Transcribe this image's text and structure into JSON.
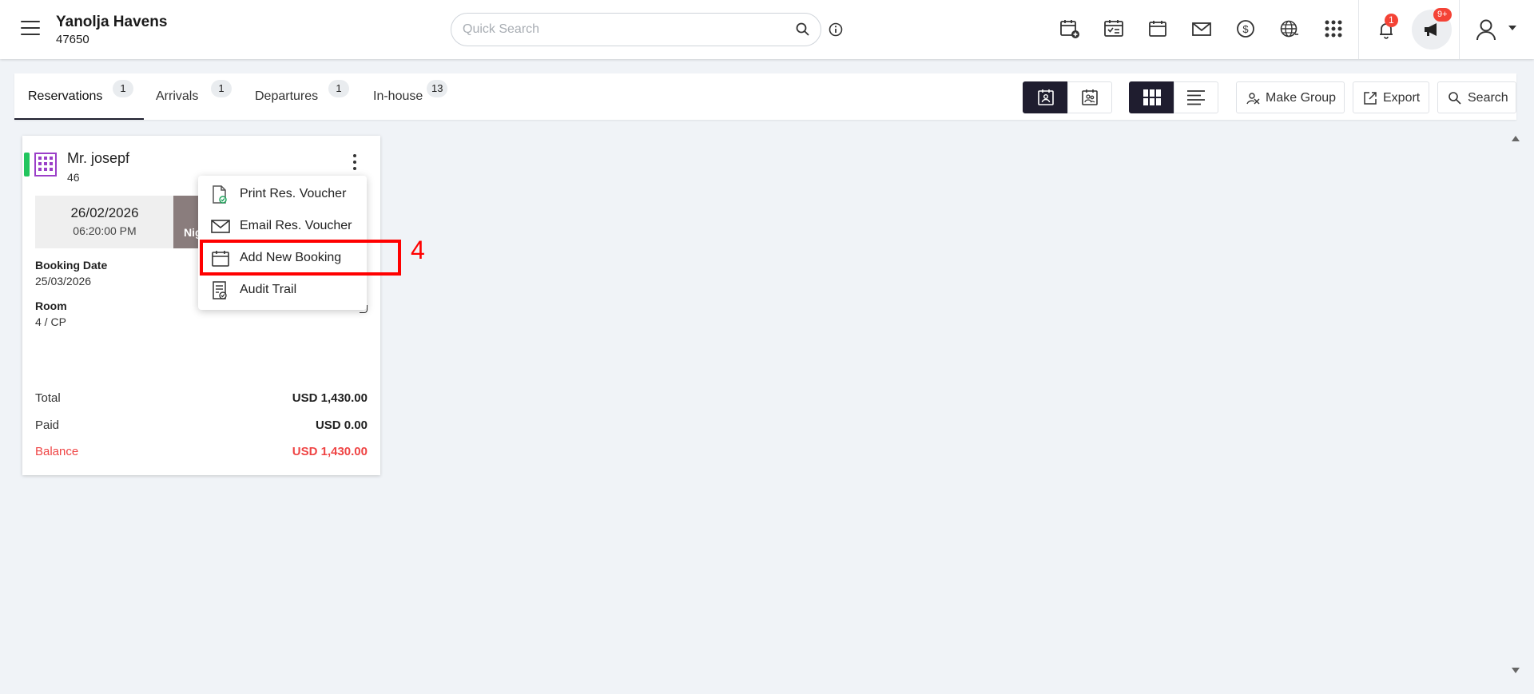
{
  "header": {
    "hotel_name": "Yanolja Havens",
    "hotel_id": "47650",
    "search_placeholder": "Quick Search",
    "notification_count": "1",
    "announcement_count": "9+"
  },
  "tabs": [
    {
      "label": "Reservations",
      "count": "1"
    },
    {
      "label": "Arrivals",
      "count": "1"
    },
    {
      "label": "Departures",
      "count": "1"
    },
    {
      "label": "In-house",
      "count": "13"
    }
  ],
  "toolbar": {
    "make_group": "Make Group",
    "export": "Export",
    "search": "Search"
  },
  "card": {
    "guest_name": "Mr. josepf",
    "guest_number": "46",
    "arrival_date": "26/02/2026",
    "arrival_time": "06:20:00 PM",
    "nights_label": "Nig",
    "booking_date_label": "Booking Date",
    "booking_date": "25/03/2026",
    "room_label": "Room",
    "room": "4 / CP",
    "total_label": "Total",
    "total": "USD 1,430.00",
    "paid_label": "Paid",
    "paid": "USD 0.00",
    "balance_label": "Balance",
    "balance": "USD 1,430.00"
  },
  "menu": {
    "items": [
      {
        "label": "Print Res. Voucher",
        "icon": "document-icon"
      },
      {
        "label": "Email Res. Voucher",
        "icon": "mail-icon"
      },
      {
        "label": "Add New Booking",
        "icon": "calendar-icon"
      },
      {
        "label": "Audit Trail",
        "icon": "audit-icon"
      }
    ]
  },
  "annotation": {
    "step": "4"
  },
  "colors": {
    "accent_dark": "#1f1d2f",
    "status_green": "#22c55e",
    "balance_red": "#ef4444",
    "badge_red": "#f44336",
    "highlight_red": "#ff0000"
  }
}
